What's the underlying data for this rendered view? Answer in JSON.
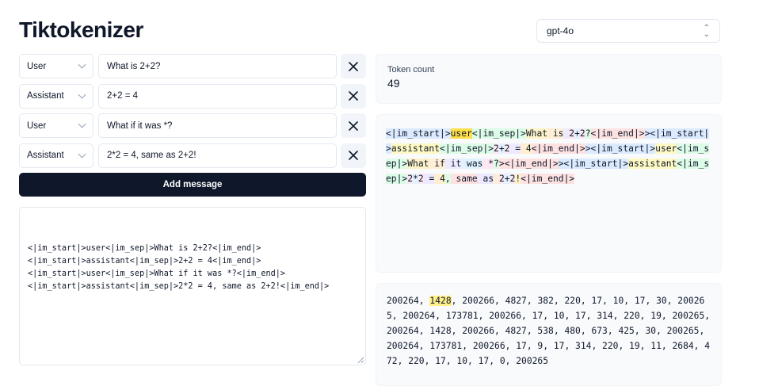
{
  "app": {
    "title": "Tiktokenizer"
  },
  "model_select": {
    "value": "gpt-4o"
  },
  "messages": [
    {
      "role": "User",
      "content": "What is 2+2?"
    },
    {
      "role": "Assistant",
      "content": "2+2 = 4"
    },
    {
      "role": "User",
      "content": "What if it was *?"
    },
    {
      "role": "Assistant",
      "content": "2*2 = 4, same as 2+2!"
    }
  ],
  "add_message_label": "Add message",
  "raw_text": "<|im_start|>user<|im_sep|>What is 2+2?<|im_end|>\n<|im_start|>assistant<|im_sep|>2+2 = 4<|im_end|>\n<|im_start|>user<|im_sep|>What if it was *?<|im_end|>\n<|im_start|>assistant<|im_sep|>2*2 = 4, same as 2+2!<|im_end|>",
  "token_count": {
    "label": "Token count",
    "value": "49"
  },
  "tokens": [
    {
      "text": "<|im_start|>",
      "color": "#dbeafe"
    },
    {
      "text": "user",
      "color": "#fde047"
    },
    {
      "text": "<|im_sep|>",
      "color": "#dcfce7"
    },
    {
      "text": "What",
      "color": "#fef3c7"
    },
    {
      "text": " is",
      "color": "#ffedd5"
    },
    {
      "text": " ",
      "color": "#ede9fe"
    },
    {
      "text": "2",
      "color": "#fce7f3"
    },
    {
      "text": "+",
      "color": "#e0f2fe"
    },
    {
      "text": "2",
      "color": "#fce7f3"
    },
    {
      "text": "?",
      "color": "#dcfce7"
    },
    {
      "text": "<|im_end|>",
      "color": "#fee2e2"
    },
    {
      "text": "><|im_start|>",
      "color": "#dbeafe"
    },
    {
      "text": "assistant",
      "color": "#fef9c3"
    },
    {
      "text": "<|im_sep|>",
      "color": "#dcfce7"
    },
    {
      "text": "2",
      "color": "#fce7f3"
    },
    {
      "text": "+",
      "color": "#e0f2fe"
    },
    {
      "text": "2",
      "color": "#fce7f3"
    },
    {
      "text": " =",
      "color": "#ede9fe"
    },
    {
      "text": " ",
      "color": "#ffedd5"
    },
    {
      "text": "4",
      "color": "#fef3c7"
    },
    {
      "text": "<|im_end|>",
      "color": "#fee2e2"
    },
    {
      "text": "><|im_start|>",
      "color": "#dbeafe"
    },
    {
      "text": "user",
      "color": "#fef9c3"
    },
    {
      "text": "<|im_sep|>",
      "color": "#dcfce7"
    },
    {
      "text": "What",
      "color": "#fef3c7"
    },
    {
      "text": " if",
      "color": "#ffedd5"
    },
    {
      "text": " it",
      "color": "#ede9fe"
    },
    {
      "text": " was",
      "color": "#e0f2fe"
    },
    {
      "text": " *",
      "color": "#fce7f3"
    },
    {
      "text": "?",
      "color": "#dcfce7"
    },
    {
      "text": "><|im_end|>",
      "color": "#fee2e2"
    },
    {
      "text": "><|im_start|>",
      "color": "#dbeafe"
    },
    {
      "text": "assistant",
      "color": "#fef9c3"
    },
    {
      "text": "<|im_sep|>",
      "color": "#dcfce7"
    },
    {
      "text": "2",
      "color": "#fce7f3"
    },
    {
      "text": "*",
      "color": "#e0f2fe"
    },
    {
      "text": "2",
      "color": "#fce7f3"
    },
    {
      "text": " =",
      "color": "#ede9fe"
    },
    {
      "text": " ",
      "color": "#ffedd5"
    },
    {
      "text": "4",
      "color": "#fef3c7"
    },
    {
      "text": ",",
      "color": "#dcfce7"
    },
    {
      "text": " same",
      "color": "#fee2e2"
    },
    {
      "text": " as",
      "color": "#ede9fe"
    },
    {
      "text": " ",
      "color": "#ffedd5"
    },
    {
      "text": "2",
      "color": "#fce7f3"
    },
    {
      "text": "+",
      "color": "#e0f2fe"
    },
    {
      "text": "2",
      "color": "#fce7f3"
    },
    {
      "text": "!",
      "color": "#fef3c7"
    },
    {
      "text": "<|im_end|>",
      "color": "#fee2e2"
    }
  ],
  "token_ids": [
    {
      "text": "200264, ",
      "highlight": false
    },
    {
      "text": "1428",
      "highlight": true
    },
    {
      "text": ", 200266, 4827, 382, 220, 17, 10, 17, 30, 200265, 200264, 173781, 200266, 17, 10, 17, 314, 220, 19, 200265, 200264, 1428, 200266, 4827, 538, 480, 673, 425, 30, 200265, 200264, 173781, 200266, 17, 9, 17, 314, 220, 19, 11, 2684, 472, 220, 17, 10, 17, 0, 200265",
      "highlight": false
    }
  ],
  "colors": {
    "primary": "#0f172a",
    "highlight": "#fef08a"
  }
}
